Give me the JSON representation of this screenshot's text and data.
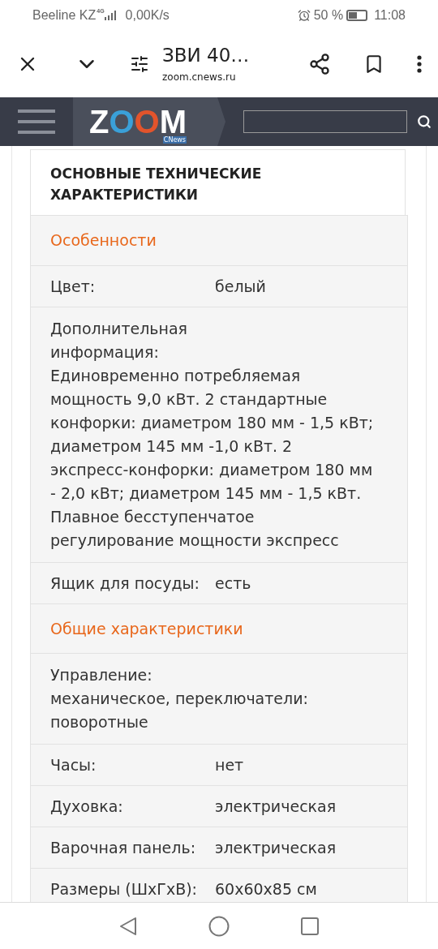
{
  "status_bar": {
    "carrier": "Beeline KZ",
    "network": "4G",
    "speed": "0,00K/s",
    "battery_text": "50 %",
    "time": "11:08"
  },
  "browser": {
    "title": "ЗВИ 40…",
    "url": "zoom.cnews.ru"
  },
  "site": {
    "logo": "ZOOM",
    "logo_sub": "CNews"
  },
  "heading": "ОСНОВНЫЕ ТЕХНИЧЕСКИЕ ХАРАКТЕРИСТИКИ",
  "rows": [
    {
      "kind": "section",
      "label": "Особенности"
    },
    {
      "kind": "pair",
      "label": "Цвет:",
      "value": "белый"
    },
    {
      "kind": "stacked",
      "label": "Дополнительная информация:",
      "value": "Единовременно потребляемая мощность 9,0 кВт. 2 стандартные конфорки: диаметром 180 мм - 1,5 кВт; диаметром 145 мм -1,0 кВт. 2 экспресс-конфорки: диаметром 180 мм - 2,0 кВт; диаметром 145 мм - 1,5 кВт. Плавное бесступенчатое регулирование мощности экспресс"
    },
    {
      "kind": "pair",
      "label": "Ящик для посуды:",
      "value": "есть"
    },
    {
      "kind": "section",
      "label": "Общие характеристики"
    },
    {
      "kind": "stacked",
      "label": "Управление:",
      "value": "механическое, переключатели: поворотные"
    },
    {
      "kind": "pair",
      "label": "Часы:",
      "value": "нет"
    },
    {
      "kind": "pair",
      "label": "Духовка:",
      "value": "электрическая"
    },
    {
      "kind": "pair",
      "label": "Варочная панель:",
      "value": "электрическая"
    },
    {
      "kind": "pair",
      "label": "Размеры (ШxГxВ):",
      "value": "60x60x85 см"
    }
  ]
}
